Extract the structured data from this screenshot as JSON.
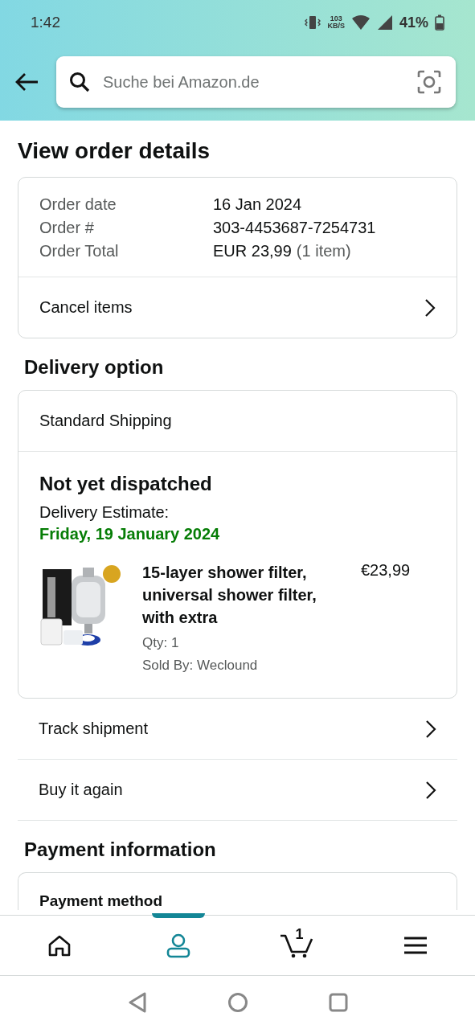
{
  "status_bar": {
    "time": "1:42",
    "speed_value": "103",
    "speed_unit": "KB/S",
    "battery": "41%"
  },
  "search": {
    "placeholder": "Suche bei Amazon.de"
  },
  "title": "View order details",
  "summary": {
    "rows": [
      {
        "label": "Order date",
        "value": "16 Jan 2024"
      },
      {
        "label": "Order #",
        "value": "303-4453687-7254731"
      },
      {
        "label": "Order Total",
        "value": "EUR 23,99",
        "note": "(1 item)"
      }
    ],
    "action": "Cancel items"
  },
  "delivery": {
    "heading": "Delivery option",
    "method": "Standard Shipping",
    "status": "Not yet dispatched",
    "estimate_label": "Delivery Estimate:",
    "estimate_date": "Friday, 19 January 2024",
    "item": {
      "kind": "picture",
      "title": "15-layer shower filter, universal shower filter, with extra",
      "price": "€23,99",
      "qty": "Qty: 1",
      "seller": "Sold By: Weclound"
    }
  },
  "actions": [
    "Track shipment",
    "Buy it again"
  ],
  "payment": {
    "heading": "Payment information",
    "method_label": "Payment method"
  },
  "nav": [
    {
      "kind": "home",
      "selected": false
    },
    {
      "kind": "account",
      "selected": true
    },
    {
      "kind": "cart",
      "selected": false,
      "count": "1"
    },
    {
      "kind": "menu",
      "selected": false
    }
  ]
}
